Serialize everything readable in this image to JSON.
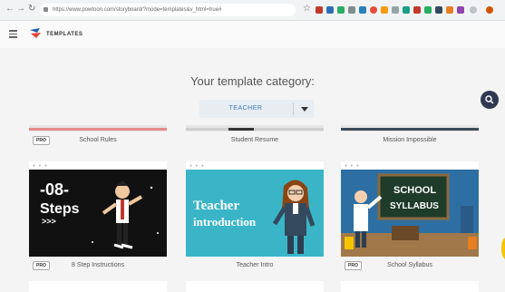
{
  "browser": {
    "url": "https://www.powtoon.com/storyboard/?mode=templates&v_html=true#"
  },
  "app": {
    "brand": "TEMPLATES"
  },
  "main": {
    "heading": "Your template category:",
    "category_selected": "TEACHER",
    "pro_badge": "PRO",
    "top_row": [
      {
        "caption": "School Rules",
        "pro": true,
        "accent_color": "#e88a8a"
      },
      {
        "caption": "Student Resume",
        "pro": false,
        "accent_color": "#cfcfcf"
      },
      {
        "caption": "Mission Impossible",
        "pro": false,
        "accent_color": "#3b4a5a"
      }
    ],
    "cards": [
      {
        "caption": "8 Step Instructions",
        "pro": true,
        "thumb_lines": [
          "-08-",
          "Steps",
          ">>>"
        ]
      },
      {
        "caption": "Teacher Intro",
        "pro": false,
        "thumb_lines": [
          "Teacher",
          "introduction"
        ]
      },
      {
        "caption": "School Syllabus",
        "pro": true,
        "thumb_lines": [
          "SCHOOL",
          "SYLLABUS"
        ]
      }
    ]
  },
  "colors": {
    "accent_blue": "#3a7ab8",
    "fab": "#2f3a52",
    "teal": "#3ab5c8",
    "dark_thumb": "#111111",
    "chalk_green": "#1f3b2a"
  },
  "icons": [
    "back-icon",
    "forward-icon",
    "reload-icon",
    "lock-icon",
    "star-icon",
    "menu-icon",
    "powtoon-logo",
    "chevron-down-icon",
    "search-icon"
  ]
}
